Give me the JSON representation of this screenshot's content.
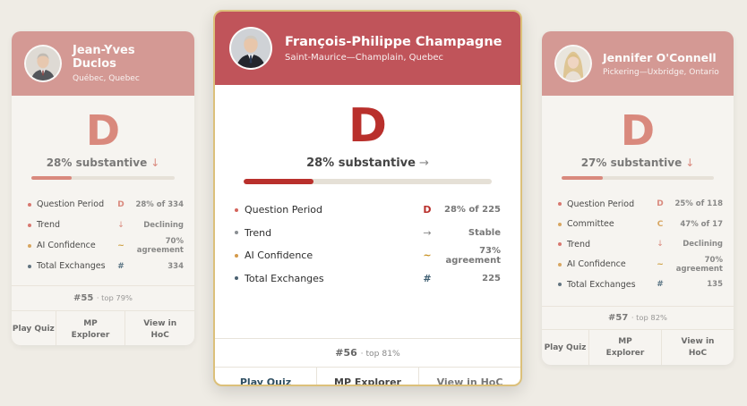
{
  "colors": {
    "background": "#efece5",
    "header_side": "#d08b86",
    "header_center": "#c0545a",
    "grade_side": "#d6786c",
    "grade_center": "#b9302c",
    "bar_fill": "#c0544f",
    "bar_track": "#e5e0d6",
    "accent_gold": "#dcc07a",
    "dot_red": "#d4645c",
    "dot_gray": "#8a8f93",
    "dot_amber": "#d49a4a",
    "dot_slate": "#4a6070",
    "icon_hash": "#3f5f72",
    "icon_tilde": "#c8901e"
  },
  "cards": [
    {
      "name": "Jean-Yves Duclos",
      "riding": "Québec, Quebec",
      "avatar_icon": "man-portrait",
      "grade": "D",
      "substantive": "28% substantive",
      "substantive_arrow": "↓",
      "progress": 0.28,
      "metrics": [
        {
          "label": "Question Period",
          "icon": "D",
          "value": "28% of 334",
          "dot": "red"
        },
        {
          "label": "Trend",
          "icon": "↓",
          "value": "Declining",
          "dot": "red"
        },
        {
          "label": "AI Confidence",
          "icon": "~",
          "value": "70% agreement",
          "dot": "amber"
        },
        {
          "label": "Total Exchanges",
          "icon": "#",
          "value": "334",
          "dot": "slate"
        }
      ],
      "rank": "#55",
      "rank_suffix": "· top 79%",
      "actions": [
        "Play Quiz",
        "MP Explorer",
        "View in HoC"
      ]
    },
    {
      "name": "François-Philippe Champagne",
      "riding": "Saint-Maurice—Champlain, Quebec",
      "avatar_icon": "man-portrait",
      "grade": "D",
      "substantive": "28% substantive",
      "substantive_arrow": "→",
      "progress": 0.28,
      "metrics": [
        {
          "label": "Question Period",
          "icon": "D",
          "value": "28% of 225",
          "dot": "red"
        },
        {
          "label": "Trend",
          "icon": "→",
          "value": "Stable",
          "dot": "gray"
        },
        {
          "label": "AI Confidence",
          "icon": "~",
          "value": "73% agreement",
          "dot": "amber"
        },
        {
          "label": "Total Exchanges",
          "icon": "#",
          "value": "225",
          "dot": "slate"
        }
      ],
      "rank": "#56",
      "rank_suffix": "· top 81%",
      "actions": [
        "Play Quiz",
        "MP Explorer",
        "View in HoC"
      ]
    },
    {
      "name": "Jennifer O'Connell",
      "riding": "Pickering—Uxbridge, Ontario",
      "avatar_icon": "woman-portrait",
      "grade": "D",
      "substantive": "27% substantive",
      "substantive_arrow": "↓",
      "progress": 0.27,
      "metrics": [
        {
          "label": "Question Period",
          "icon": "D",
          "value": "25% of 118",
          "dot": "red"
        },
        {
          "label": "Committee",
          "icon": "C",
          "value": "47% of 17",
          "dot": "amber"
        },
        {
          "label": "Trend",
          "icon": "↓",
          "value": "Declining",
          "dot": "red"
        },
        {
          "label": "AI Confidence",
          "icon": "~",
          "value": "70% agreement",
          "dot": "amber"
        },
        {
          "label": "Total Exchanges",
          "icon": "#",
          "value": "135",
          "dot": "slate"
        }
      ],
      "rank": "#57",
      "rank_suffix": "· top 82%",
      "actions": [
        "Play Quiz",
        "MP Explorer",
        "View in HoC"
      ]
    }
  ]
}
